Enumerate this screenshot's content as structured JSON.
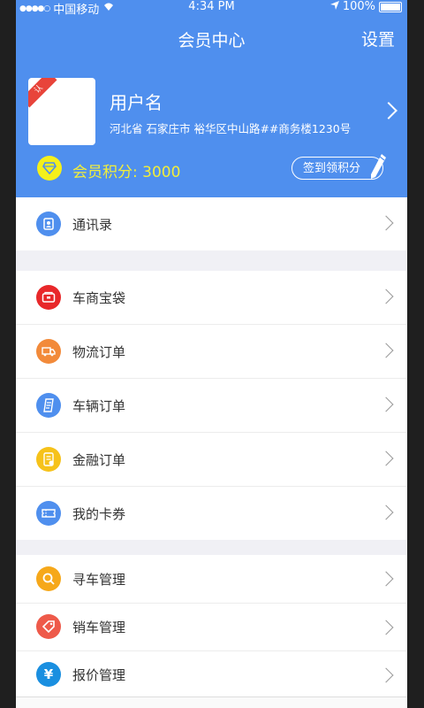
{
  "status_bar": {
    "signal": "●●●●○",
    "carrier": "中国移动",
    "time": "4:34 PM",
    "battery": "100%"
  },
  "nav": {
    "title": "会员中心",
    "settings": "设置"
  },
  "profile": {
    "badge": "认",
    "username": "用户名",
    "address": "河北省 石家庄市 裕华区中山路##商务楼1230号",
    "points_label": "会员积分:",
    "points_value": "3000",
    "signin_button": "签到领积分"
  },
  "sections": [
    {
      "items": [
        {
          "label": "通讯录",
          "icon": "contacts-icon",
          "color": "#4f8fee"
        }
      ]
    },
    {
      "items": [
        {
          "label": "车商宝袋",
          "icon": "wallet-icon",
          "color": "#e8282a"
        },
        {
          "label": "物流订单",
          "icon": "truck-icon",
          "color": "#f28a3a"
        },
        {
          "label": "车辆订单",
          "icon": "document-icon",
          "color": "#4f8fee"
        },
        {
          "label": "金融订单",
          "icon": "finance-icon",
          "color": "#f6c21a"
        },
        {
          "label": "我的卡券",
          "icon": "ticket-icon",
          "color": "#4f8fee"
        }
      ]
    },
    {
      "items": [
        {
          "label": "寻车管理",
          "icon": "search-icon",
          "color": "#f6a81a"
        },
        {
          "label": "销车管理",
          "icon": "tag-icon",
          "color": "#ee5a4a"
        },
        {
          "label": "报价管理",
          "icon": "yen-icon",
          "color": "#1a8fe0"
        }
      ]
    }
  ]
}
